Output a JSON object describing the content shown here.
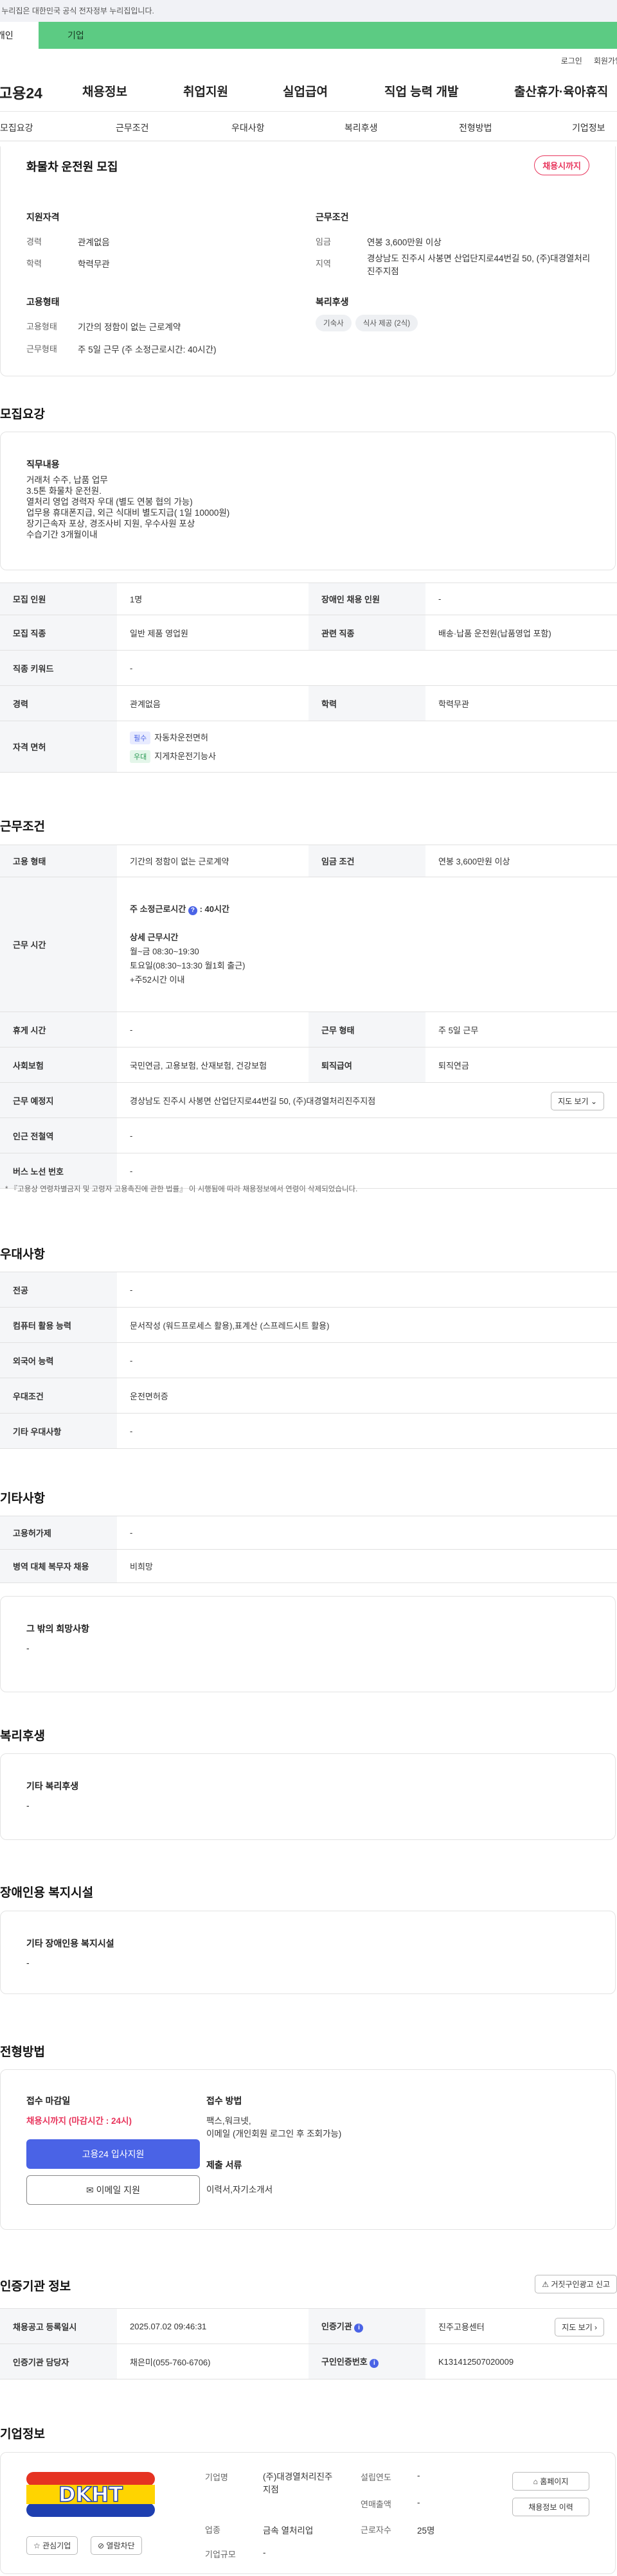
{
  "gov_banner": "이 누리집은 대한민국 공식 전자정부 누리집입니다.",
  "tabs": [
    "개인",
    "기업"
  ],
  "util": [
    "로그인",
    "회원가입"
  ],
  "logo": "고용24",
  "gnb": [
    "채용정보",
    "취업지원",
    "실업급여",
    "직업 능력 개발",
    "출산휴가·육아휴직"
  ],
  "subnav": [
    "모집요강",
    "근무조건",
    "우대사항",
    "복리후생",
    "전형방법",
    "기업정보"
  ],
  "job": {
    "title": "화물차 운전원 모집",
    "badge": "채용시까지"
  },
  "summary": {
    "qual_title": "지원자격",
    "exp_label": "경력",
    "exp": "관계없음",
    "edu_label": "학력",
    "edu": "학력무관",
    "cond_title": "근무조건",
    "wage_label": "임금",
    "wage": "연봉 3,600만원 이상",
    "area_label": "지역",
    "area": "경상남도 진주시 사봉면 산업단지로44번길 50, (주)대경열처리진주지점",
    "emp_title": "고용형태",
    "type_label": "고용형태",
    "type": "기간의 정함이 없는 근로계약",
    "form_label": "근무형태",
    "form": "주 5일 근무 (주 소정근로시간: 40시간)",
    "welfare_title": "복리후생",
    "welfare_tags": [
      "기숙사",
      "식사 제공 (2식)"
    ]
  },
  "s_recruit": "모집요강",
  "duty": {
    "title": "직무내용",
    "lines": [
      "거래처 수주, 납품 업무",
      "3.5톤 화물차 운전원.",
      "열처리 영업 경력자 우대 (별도 연봉 협의 가능)",
      "업무용 휴대폰지급, 외근 식대비 별도지급( 1일 10000원)",
      "장기근속자 포상, 경조사비 지원, 우수사원 포상",
      "수습기간 3개월이내"
    ]
  },
  "rec_table": {
    "r1": [
      "모집 인원",
      "1명",
      "장애인 채용 인원",
      "-"
    ],
    "r2": [
      "모집 직종",
      "일반 제품 영업원",
      "관련 직종",
      "배송·납품 운전원(납품영업 포함)"
    ],
    "r3": [
      "직종 키워드",
      "-"
    ],
    "r4": [
      "경력",
      "관계없음",
      "학력",
      "학력무관"
    ],
    "r5": {
      "label": "자격 면허",
      "items": [
        {
          "tag": "필수",
          "name": "자동차운전면허"
        },
        {
          "tag": "우대",
          "name": "지게차운전기능사"
        }
      ]
    }
  },
  "s_cond": "근무조건",
  "cond_table": {
    "r1": [
      "고용 형태",
      "기간의 정함이 없는 근로계약",
      "임금 조건",
      "연봉 3,600만원 이상"
    ],
    "r2": {
      "label": "근무 시간",
      "weekly": "주 소정근로시간",
      "weekly_val": ": 40시간",
      "detail_title": "상세 근무시간",
      "lines": [
        "월~금 08:30~19:30",
        "토요일(08:30~13:30 월1회 출근)",
        "+주52시간 이내"
      ]
    },
    "r3": [
      "휴게 시간",
      "-",
      "근무 형태",
      "주 5일 근무"
    ],
    "r4": [
      "사회보험",
      "국민연금, 고용보험, 산재보험, 건강보험",
      "퇴직급여",
      "퇴직연금"
    ],
    "r5": {
      "label": "근무 예정지",
      "value": "경상남도 진주시 사봉면 산업단지로44번길 50, (주)대경열처리진주지점",
      "btn": "지도 보기"
    },
    "r6": [
      "인근 전철역",
      "-"
    ],
    "r7": [
      "버스 노선 번호",
      "-"
    ]
  },
  "cond_note": "* 『고용상 연령차별금지 및 고령자 고용촉진에 관한 법률』 이 시행됨에 따라 채용정보에서 연령이 삭제되었습니다.",
  "s_pref": "우대사항",
  "pref_table": [
    [
      "전공",
      "-"
    ],
    [
      "컴퓨터 활용 능력",
      "문서작성 (워드프로세스 활용),표계산 (스프레드시트 활용)"
    ],
    [
      "외국어 능력",
      "-"
    ],
    [
      "우대조건",
      "운전면허증"
    ],
    [
      "기타 우대사항",
      "-"
    ]
  ],
  "s_etc": "기타사항",
  "etc_table": [
    [
      "고용허가제",
      "-"
    ],
    [
      "병역 대체 복무자 채용",
      "비희망"
    ]
  ],
  "etc_box": {
    "title": "그 밖의 희망사항",
    "value": "-"
  },
  "s_welfare": "복리후생",
  "welfare_box": {
    "title": "기타 복리후생",
    "value": "-"
  },
  "s_disab": "장애인용 복지시설",
  "disab_box": {
    "title": "기타 장애인용 복지시설",
    "value": "-"
  },
  "s_proc": "전형방법",
  "proc": {
    "deadline_label": "접수 마감일",
    "deadline": "채용시까지 (마감시간 : 24시)",
    "apply_btn": "고용24 입사지원",
    "email_btn": "이메일 지원",
    "method_label": "접수 방법",
    "method": [
      "팩스,워크넷,",
      "이메일 (개인회원 로그인 후 조회가능)"
    ],
    "docs_label": "제출 서류",
    "docs": "이력서,자기소개서"
  },
  "s_auth": "인증기관 정보",
  "auth_btn": "거짓구인광고 신고",
  "auth_table": {
    "r1": [
      "채용공고 등록일시",
      "2025.07.02 09:46:31",
      "인증기관",
      "진주고용센터",
      "지도 보기"
    ],
    "r2": [
      "인증기관 담당자",
      "채은미(055-760-6706)",
      "구인인증번호",
      "K131412507020009"
    ]
  },
  "s_company": "기업정보",
  "company": {
    "logo_text": "DKHT",
    "fav": "관심기업",
    "block": "열람차단",
    "name_label": "기업명",
    "name": "(주)대경열처리진주지점",
    "year_label": "설립연도",
    "year": "-",
    "sales_label": "연매출액",
    "sales": "-",
    "ind_label": "업종",
    "ind": "금속 열처리업",
    "emp_label": "근로자수",
    "emp": "25명",
    "size_label": "기업규모",
    "size": "-",
    "home_btn": "홈페이지",
    "list_btn": "채용정보 이력"
  },
  "colors": {
    "green": "#5ccb83",
    "accent": "#e8365d",
    "primary": "#4a63e6"
  }
}
